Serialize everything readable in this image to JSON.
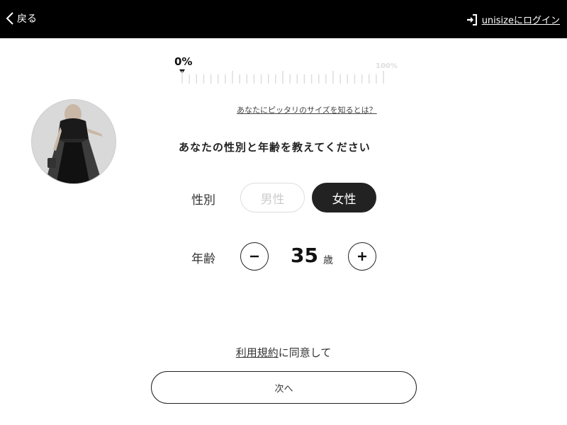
{
  "header": {
    "back_label": "戻る",
    "login_label": "unisizeにログイン",
    "back_icon": "chevron-left-icon",
    "login_icon": "sign-in-icon"
  },
  "progress": {
    "current_label": "0%",
    "max_label": "100%",
    "value": 0
  },
  "help_link": "あなたにピッタリのサイズを知るとは？",
  "question": "あなたの性別と年齢を教えてください",
  "gender": {
    "label": "性別",
    "options": [
      "男性",
      "女性"
    ],
    "selected": "女性"
  },
  "age": {
    "label": "年齢",
    "value": "35",
    "unit": "歳",
    "minus_icon": "minus-icon",
    "plus_icon": "plus-icon"
  },
  "terms": {
    "link_text": "利用規約",
    "suffix": "に同意して"
  },
  "next_button": "次へ",
  "colors": {
    "header_bg": "#000000",
    "selected_pill": "#222222",
    "unselected_text": "#cccccc"
  }
}
